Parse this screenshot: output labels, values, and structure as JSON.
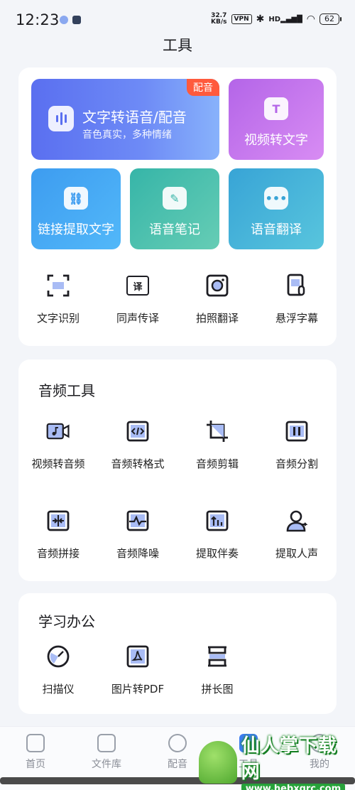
{
  "status_bar": {
    "time": "12:23",
    "speed_value": "32.7",
    "speed_unit": "KB/s",
    "vpn": "VPN",
    "network": "HD",
    "battery": "62"
  },
  "page_title": "工具",
  "featured": {
    "tts": {
      "title": "文字转语音/配音",
      "subtitle": "音色真实，多种情绪",
      "badge": "配音"
    },
    "video_to_text": {
      "label": "视频转文字",
      "icon_glyph": "T"
    },
    "link_extract": {
      "label": "链接提取文字"
    },
    "voice_notes": {
      "label": "语音笔记"
    },
    "voice_translate": {
      "label": "语音翻译"
    }
  },
  "quick_tools": [
    {
      "label": "文字识别",
      "icon": "scan-text-icon"
    },
    {
      "label": "同声传译",
      "icon": "interpret-icon",
      "glyph": "译"
    },
    {
      "label": "拍照翻译",
      "icon": "camera-translate-icon"
    },
    {
      "label": "悬浮字幕",
      "icon": "floating-subtitle-icon"
    }
  ],
  "audio_tools": {
    "title": "音频工具",
    "items": [
      {
        "label": "视频转音频",
        "icon": "video-audio-icon"
      },
      {
        "label": "音频转格式",
        "icon": "audio-format-icon"
      },
      {
        "label": "音频剪辑",
        "icon": "audio-crop-icon"
      },
      {
        "label": "音频分割",
        "icon": "audio-split-icon"
      },
      {
        "label": "音频拼接",
        "icon": "audio-merge-icon"
      },
      {
        "label": "音频降噪",
        "icon": "audio-denoise-icon"
      },
      {
        "label": "提取伴奏",
        "icon": "extract-accompaniment-icon"
      },
      {
        "label": "提取人声",
        "icon": "extract-vocal-icon"
      }
    ]
  },
  "study_office": {
    "title": "学习办公",
    "items": [
      {
        "label": "扫描仪",
        "icon": "scanner-icon"
      },
      {
        "label": "图片转PDF",
        "icon": "image-pdf-icon"
      },
      {
        "label": "拼长图",
        "icon": "long-image-icon"
      }
    ]
  },
  "bottom_nav": [
    {
      "label": "首页",
      "icon": "home-icon"
    },
    {
      "label": "文件库",
      "icon": "folder-icon"
    },
    {
      "label": "配音",
      "icon": "dubbing-icon"
    },
    {
      "label": "工具",
      "icon": "tools-icon"
    },
    {
      "label": "我的",
      "icon": "profile-icon"
    }
  ],
  "watermark": {
    "name": "仙人掌下载网",
    "url": "www.hebxqrc.com"
  }
}
